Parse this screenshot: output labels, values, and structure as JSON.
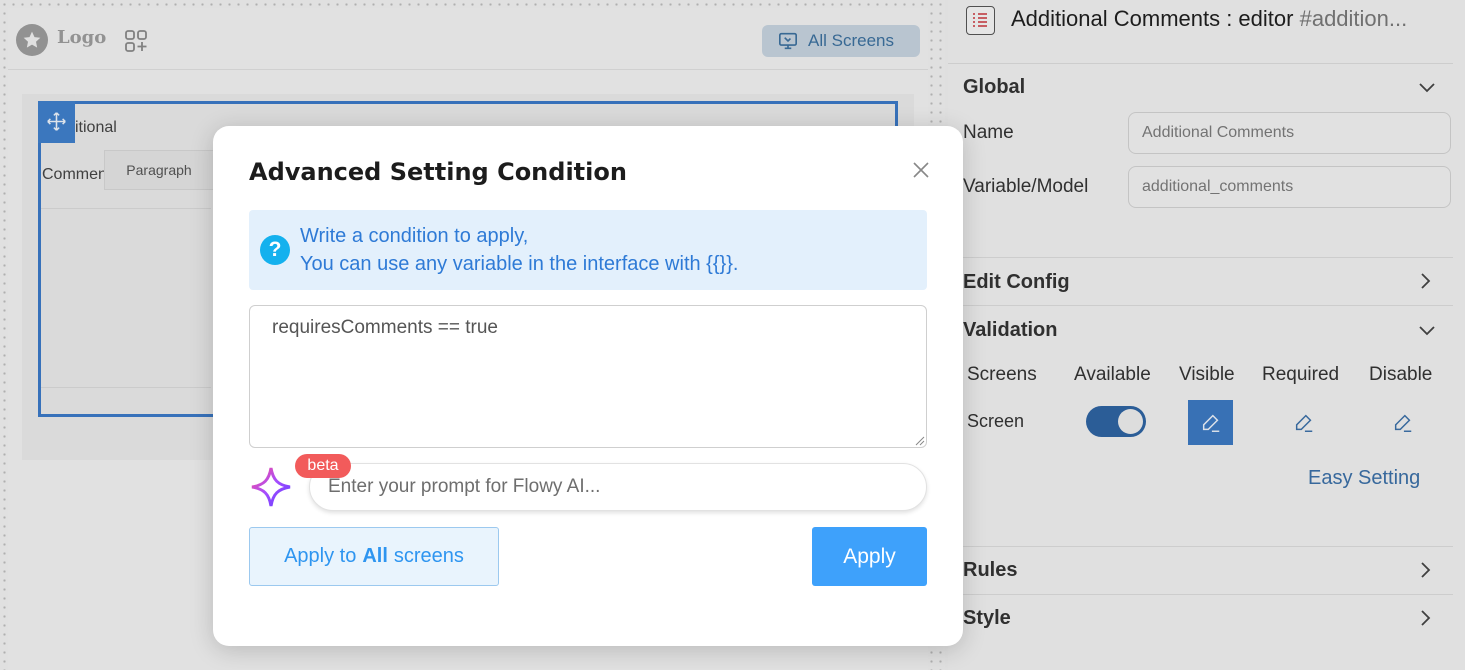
{
  "canvas": {
    "logo_text": "Logo",
    "all_screens_label": "All Screens",
    "field_label_line1": "itional",
    "field_label_line2": "Commen",
    "paragraph_tab": "Paragraph"
  },
  "panel": {
    "title": "Additional Comments : editor",
    "title_hash": "#addition...",
    "sections": {
      "global": "Global",
      "edit_config": "Edit Config",
      "validation": "Validation",
      "rules": "Rules",
      "style": "Style"
    },
    "name_label": "Name",
    "name_value": "Additional Comments",
    "variable_label": "Variable/Model",
    "variable_value": "additional_comments",
    "validation": {
      "headers": [
        "Screens",
        "Available",
        "Visible",
        "Required",
        "Disable"
      ],
      "row_label": "Screen",
      "available_on": true,
      "easy_setting": "Easy Setting"
    }
  },
  "modal": {
    "title": "Advanced Setting Condition",
    "info_line1": "Write a condition to apply,",
    "info_line2": "You can use any variable in the interface with {{}}.",
    "condition_value": "requiresComments == true",
    "beta_badge": "beta",
    "prompt_placeholder": "Enter your prompt for Flowy AI...",
    "apply_all_prefix": "Apply to",
    "apply_all_bold": "All",
    "apply_all_suffix": "screens",
    "apply_label": "Apply"
  },
  "colors": {
    "primary": "#3ea1fb",
    "info_bg": "#e3f0fc",
    "info_text": "#2e7ad6",
    "beta": "#f25b5b",
    "selection": "#3a78c5"
  }
}
